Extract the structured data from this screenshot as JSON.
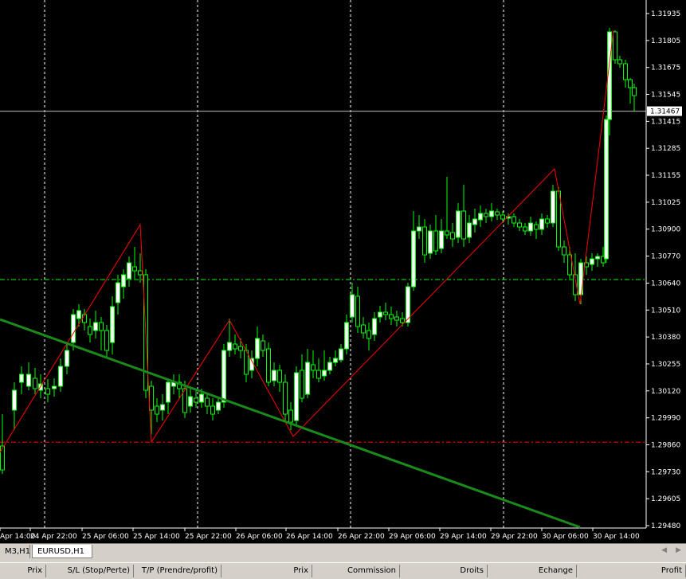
{
  "chart": {
    "symbol": "EURUSD",
    "timeframe": "H1",
    "background": "#000000",
    "grid_color": "#ffffff",
    "candle_color": "#00ff00",
    "bull_fill": "#ffffff",
    "bear_fill": "#000000",
    "zigzag_color": "#ff0000",
    "trendline_color": "#1a8a1a",
    "green_level_color": "#00ff00",
    "red_level_color": "#ff0000",
    "current_price": "1.31467",
    "green_level": 1.3066,
    "red_level": 1.2988,
    "price_labels": [
      "1.31935",
      "1.31805",
      "1.31675",
      "1.31545",
      "1.31415",
      "1.31285",
      "1.31155",
      "1.31025",
      "1.30900",
      "1.30770",
      "1.30640",
      "1.30510",
      "1.30380",
      "1.30255",
      "1.30120",
      "1.29990",
      "1.29860",
      "1.29730",
      "1.29605",
      "1.29480"
    ],
    "time_labels": [
      "Apr 14:00",
      "24 Apr 22:00",
      "25 Apr 06:00",
      "25 Apr 14:00",
      "25 Apr 22:00",
      "26 Apr 06:00",
      "26 Apr 14:00",
      "26 Apr 22:00",
      "29 Apr 06:00",
      "29 Apr 14:00",
      "29 Apr 22:00",
      "30 Apr 06:00",
      "30 Apr 14:00"
    ]
  },
  "tabs": {
    "items": [
      {
        "label": "M3,H1",
        "active": false
      },
      {
        "label": "EURUSD,H1",
        "active": true
      }
    ],
    "scroll_left": "◀",
    "scroll_right": "▶"
  },
  "columns": [
    "Prix",
    "S/L (Stop/Perte)",
    "T/P (Prendre/profit)",
    "Prix",
    "Commission",
    "Droits",
    "Echange",
    "Profit"
  ]
}
